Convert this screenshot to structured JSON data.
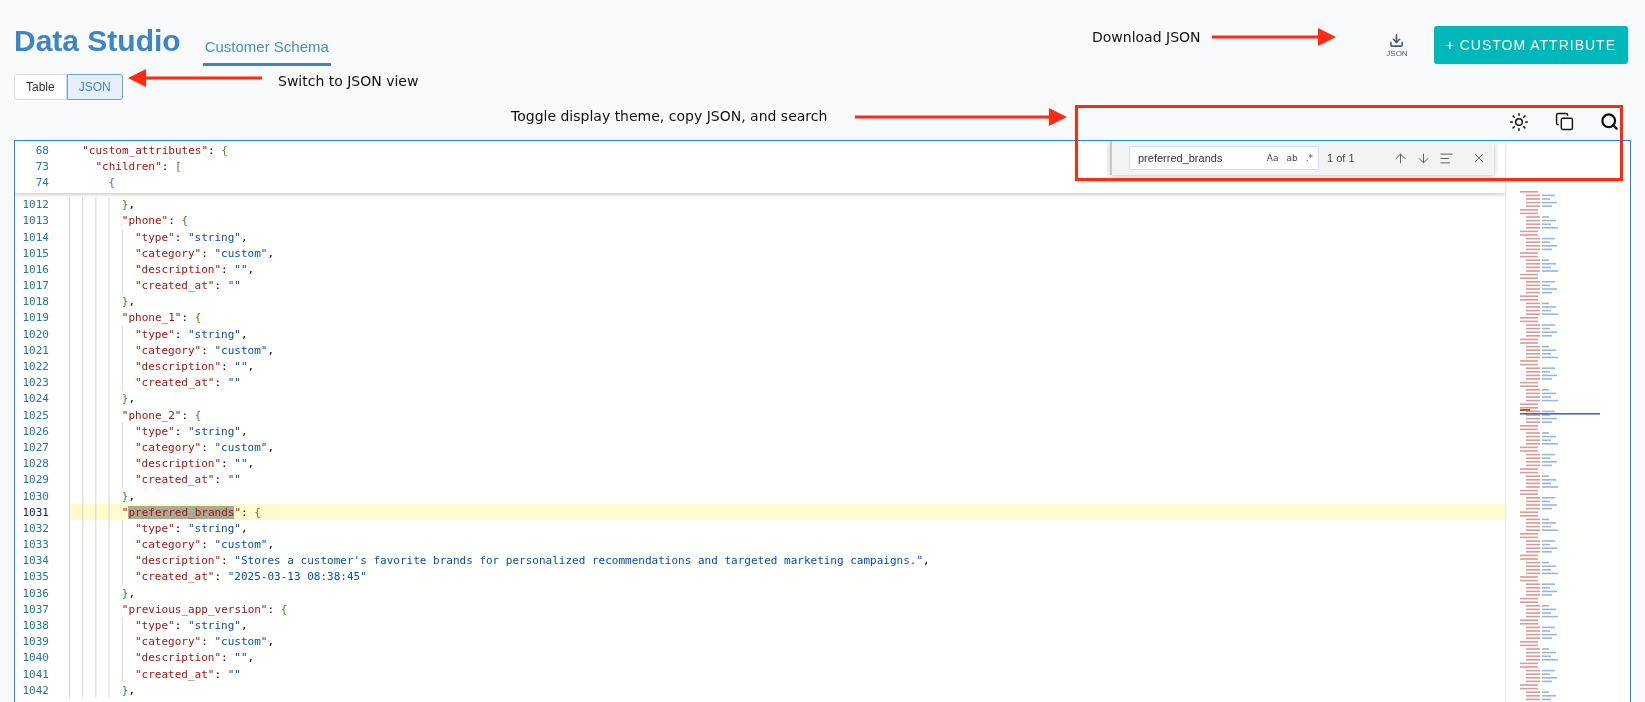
{
  "header": {
    "title": "Data Studio",
    "tabs": [
      {
        "label": "Customer Schema",
        "selected": true
      }
    ],
    "view_toggle": [
      {
        "label": "Table",
        "selected": false
      },
      {
        "label": "JSON",
        "selected": true
      }
    ],
    "download": {
      "label": "JSON"
    },
    "add_button": {
      "label": "+ CUSTOM ATTRIBUTE"
    }
  },
  "annotations": [
    {
      "text": "Switch to JSON view"
    },
    {
      "text": "Download JSON"
    },
    {
      "text": "Toggle display theme, copy JSON, and search"
    }
  ],
  "find_widget": {
    "value": "preferred_brands",
    "options": [
      {
        "label": "Aa",
        "on": false
      },
      {
        "label": "ab",
        "on": false
      },
      {
        "label": ".*",
        "on": false
      }
    ],
    "result": "1 of 1"
  },
  "editor": {
    "sticky_lines": [
      {
        "num": "68",
        "kind": "root",
        "tokens": [
          {
            "kind": "key",
            "text": "\"custom_attributes\""
          },
          {
            "kind": "punct",
            "text": ": "
          },
          {
            "kind": "brace",
            "text": "{"
          }
        ]
      },
      {
        "num": "73",
        "kind": "array",
        "tokens": [
          {
            "kind": "key",
            "text": "\"children\""
          },
          {
            "kind": "punct",
            "text": ": "
          },
          {
            "kind": "square",
            "text": "["
          }
        ]
      },
      {
        "num": "74",
        "kind": "item",
        "tokens": [
          {
            "kind": "inner",
            "text": "{"
          }
        ]
      }
    ],
    "lines": [
      {
        "num": "1012",
        "kind": "object",
        "current": false,
        "tokens": [
          {
            "kind": "brace",
            "text": "}"
          },
          {
            "kind": "punct",
            "text": ","
          }
        ]
      },
      {
        "num": "1013",
        "kind": "object",
        "current": false,
        "tokens": [
          {
            "kind": "key",
            "text": "\"phone\""
          },
          {
            "kind": "punct",
            "text": ": "
          },
          {
            "kind": "brace",
            "text": "{"
          }
        ]
      },
      {
        "num": "1014",
        "kind": "field",
        "current": false,
        "tokens": [
          {
            "kind": "key",
            "text": "\"type\""
          },
          {
            "kind": "punct",
            "text": ": "
          },
          {
            "kind": "string",
            "text": "\"string\""
          },
          {
            "kind": "punct",
            "text": ","
          }
        ]
      },
      {
        "num": "1015",
        "kind": "field",
        "current": false,
        "tokens": [
          {
            "kind": "key",
            "text": "\"category\""
          },
          {
            "kind": "punct",
            "text": ": "
          },
          {
            "kind": "string",
            "text": "\"custom\""
          },
          {
            "kind": "punct",
            "text": ","
          }
        ]
      },
      {
        "num": "1016",
        "kind": "field",
        "current": false,
        "tokens": [
          {
            "kind": "key",
            "text": "\"description\""
          },
          {
            "kind": "punct",
            "text": ": "
          },
          {
            "kind": "string",
            "text": "\"\""
          },
          {
            "kind": "punct",
            "text": ","
          }
        ]
      },
      {
        "num": "1017",
        "kind": "field",
        "current": false,
        "tokens": [
          {
            "kind": "key",
            "text": "\"created_at\""
          },
          {
            "kind": "punct",
            "text": ": "
          },
          {
            "kind": "string",
            "text": "\"\""
          }
        ]
      },
      {
        "num": "1018",
        "kind": "object",
        "current": false,
        "tokens": [
          {
            "kind": "brace",
            "text": "}"
          },
          {
            "kind": "punct",
            "text": ","
          }
        ]
      },
      {
        "num": "1019",
        "kind": "object",
        "current": false,
        "tokens": [
          {
            "kind": "key",
            "text": "\"phone_1\""
          },
          {
            "kind": "punct",
            "text": ": "
          },
          {
            "kind": "brace",
            "text": "{"
          }
        ]
      },
      {
        "num": "1020",
        "kind": "field",
        "current": false,
        "tokens": [
          {
            "kind": "key",
            "text": "\"type\""
          },
          {
            "kind": "punct",
            "text": ": "
          },
          {
            "kind": "string",
            "text": "\"string\""
          },
          {
            "kind": "punct",
            "text": ","
          }
        ]
      },
      {
        "num": "1021",
        "kind": "field",
        "current": false,
        "tokens": [
          {
            "kind": "key",
            "text": "\"category\""
          },
          {
            "kind": "punct",
            "text": ": "
          },
          {
            "kind": "string",
            "text": "\"custom\""
          },
          {
            "kind": "punct",
            "text": ","
          }
        ]
      },
      {
        "num": "1022",
        "kind": "field",
        "current": false,
        "tokens": [
          {
            "kind": "key",
            "text": "\"description\""
          },
          {
            "kind": "punct",
            "text": ": "
          },
          {
            "kind": "string",
            "text": "\"\""
          },
          {
            "kind": "punct",
            "text": ","
          }
        ]
      },
      {
        "num": "1023",
        "kind": "field",
        "current": false,
        "tokens": [
          {
            "kind": "key",
            "text": "\"created_at\""
          },
          {
            "kind": "punct",
            "text": ": "
          },
          {
            "kind": "string",
            "text": "\"\""
          }
        ]
      },
      {
        "num": "1024",
        "kind": "object",
        "current": false,
        "tokens": [
          {
            "kind": "brace",
            "text": "}"
          },
          {
            "kind": "punct",
            "text": ","
          }
        ]
      },
      {
        "num": "1025",
        "kind": "object",
        "current": false,
        "tokens": [
          {
            "kind": "key",
            "text": "\"phone_2\""
          },
          {
            "kind": "punct",
            "text": ": "
          },
          {
            "kind": "brace",
            "text": "{"
          }
        ]
      },
      {
        "num": "1026",
        "kind": "field",
        "current": false,
        "tokens": [
          {
            "kind": "key",
            "text": "\"type\""
          },
          {
            "kind": "punct",
            "text": ": "
          },
          {
            "kind": "string",
            "text": "\"string\""
          },
          {
            "kind": "punct",
            "text": ","
          }
        ]
      },
      {
        "num": "1027",
        "kind": "field",
        "current": false,
        "tokens": [
          {
            "kind": "key",
            "text": "\"category\""
          },
          {
            "kind": "punct",
            "text": ": "
          },
          {
            "kind": "string",
            "text": "\"custom\""
          },
          {
            "kind": "punct",
            "text": ","
          }
        ]
      },
      {
        "num": "1028",
        "kind": "field",
        "current": false,
        "tokens": [
          {
            "kind": "key",
            "text": "\"description\""
          },
          {
            "kind": "punct",
            "text": ": "
          },
          {
            "kind": "string",
            "text": "\"\""
          },
          {
            "kind": "punct",
            "text": ","
          }
        ]
      },
      {
        "num": "1029",
        "kind": "field",
        "current": false,
        "tokens": [
          {
            "kind": "key",
            "text": "\"created_at\""
          },
          {
            "kind": "punct",
            "text": ": "
          },
          {
            "kind": "string",
            "text": "\"\""
          }
        ]
      },
      {
        "num": "1030",
        "kind": "object",
        "current": false,
        "tokens": [
          {
            "kind": "brace",
            "text": "}"
          },
          {
            "kind": "punct",
            "text": ","
          }
        ]
      },
      {
        "num": "1031",
        "kind": "object",
        "current": true,
        "tokens": [
          {
            "kind": "key",
            "text": "\""
          },
          {
            "kind": "match",
            "text": "preferred_brands"
          },
          {
            "kind": "key",
            "text": "\""
          },
          {
            "kind": "punct",
            "text": ": "
          },
          {
            "kind": "brace",
            "text": "{"
          }
        ]
      },
      {
        "num": "1032",
        "kind": "field",
        "current": false,
        "tokens": [
          {
            "kind": "key",
            "text": "\"type\""
          },
          {
            "kind": "punct",
            "text": ": "
          },
          {
            "kind": "string",
            "text": "\"string\""
          },
          {
            "kind": "punct",
            "text": ","
          }
        ]
      },
      {
        "num": "1033",
        "kind": "field",
        "current": false,
        "tokens": [
          {
            "kind": "key",
            "text": "\"category\""
          },
          {
            "kind": "punct",
            "text": ": "
          },
          {
            "kind": "string",
            "text": "\"custom\""
          },
          {
            "kind": "punct",
            "text": ","
          }
        ]
      },
      {
        "num": "1034",
        "kind": "field",
        "current": false,
        "tokens": [
          {
            "kind": "key",
            "text": "\"description\""
          },
          {
            "kind": "punct",
            "text": ": "
          },
          {
            "kind": "string",
            "text": "\"Stores a customer's favorite brands for personalized recommendations and targeted marketing campaigns.\""
          },
          {
            "kind": "punct",
            "text": ","
          }
        ]
      },
      {
        "num": "1035",
        "kind": "field",
        "current": false,
        "tokens": [
          {
            "kind": "key",
            "text": "\"created_at\""
          },
          {
            "kind": "punct",
            "text": ": "
          },
          {
            "kind": "string",
            "text": "\"2025-03-13 08:38:45\""
          }
        ]
      },
      {
        "num": "1036",
        "kind": "object",
        "current": false,
        "tokens": [
          {
            "kind": "brace",
            "text": "}"
          },
          {
            "kind": "punct",
            "text": ","
          }
        ]
      },
      {
        "num": "1037",
        "kind": "object",
        "current": false,
        "tokens": [
          {
            "kind": "key",
            "text": "\"previous_app_version\""
          },
          {
            "kind": "punct",
            "text": ": "
          },
          {
            "kind": "brace",
            "text": "{"
          }
        ]
      },
      {
        "num": "1038",
        "kind": "field",
        "current": false,
        "tokens": [
          {
            "kind": "key",
            "text": "\"type\""
          },
          {
            "kind": "punct",
            "text": ": "
          },
          {
            "kind": "string",
            "text": "\"string\""
          },
          {
            "kind": "punct",
            "text": ","
          }
        ]
      },
      {
        "num": "1039",
        "kind": "field",
        "current": false,
        "tokens": [
          {
            "kind": "key",
            "text": "\"category\""
          },
          {
            "kind": "punct",
            "text": ": "
          },
          {
            "kind": "string",
            "text": "\"custom\""
          },
          {
            "kind": "punct",
            "text": ","
          }
        ]
      },
      {
        "num": "1040",
        "kind": "field",
        "current": false,
        "tokens": [
          {
            "kind": "key",
            "text": "\"description\""
          },
          {
            "kind": "punct",
            "text": ": "
          },
          {
            "kind": "string",
            "text": "\"\""
          },
          {
            "kind": "punct",
            "text": ","
          }
        ]
      },
      {
        "num": "1041",
        "kind": "field",
        "current": false,
        "tokens": [
          {
            "kind": "key",
            "text": "\"created_at\""
          },
          {
            "kind": "punct",
            "text": ": "
          },
          {
            "kind": "string",
            "text": "\"\""
          }
        ]
      },
      {
        "num": "1042",
        "kind": "object",
        "current": false,
        "tokens": [
          {
            "kind": "brace",
            "text": "}"
          },
          {
            "kind": "punct",
            "text": ","
          }
        ]
      }
    ]
  }
}
